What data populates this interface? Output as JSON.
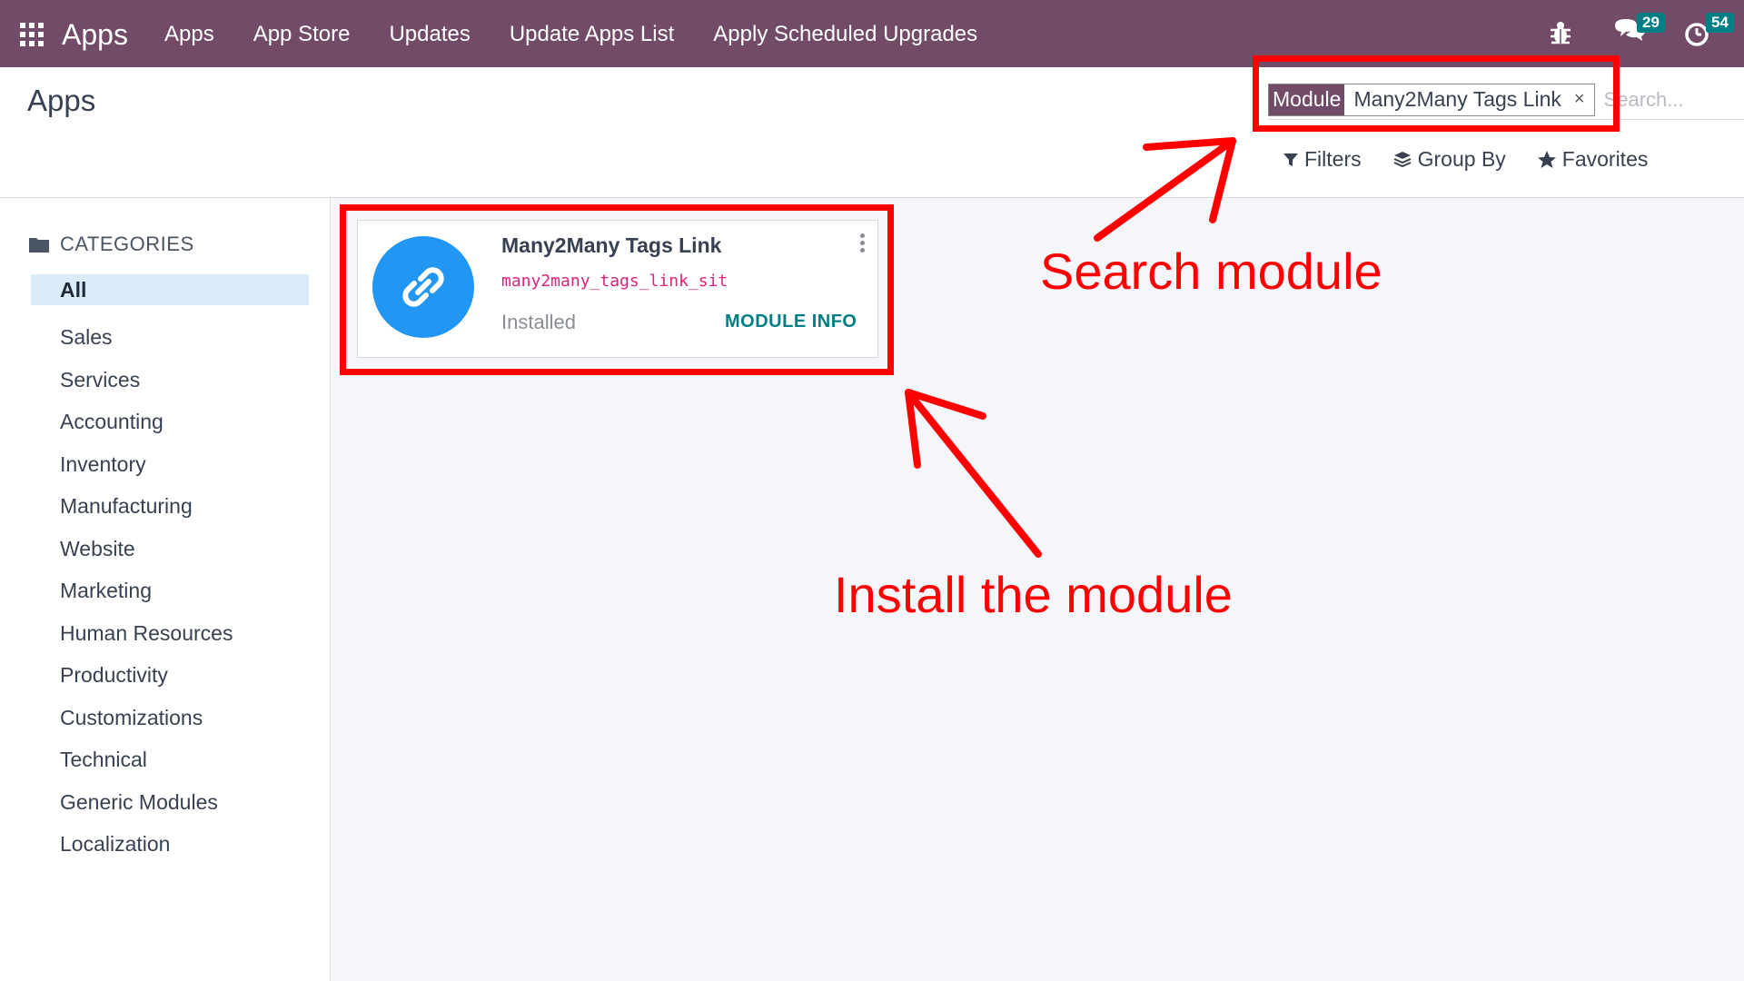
{
  "topbar": {
    "brand": "Apps",
    "menu": [
      "Apps",
      "App Store",
      "Updates",
      "Update Apps List",
      "Apply Scheduled Upgrades"
    ],
    "messages_count": "29",
    "activities_count": "54"
  },
  "control_panel": {
    "title": "Apps",
    "search": {
      "facet_label": "Module",
      "facet_value": "Many2Many Tags Link",
      "facet_close": "×",
      "placeholder": "Search..."
    },
    "filters_label": "Filters",
    "groupby_label": "Group By",
    "favorites_label": "Favorites"
  },
  "sidebar": {
    "header": "CATEGORIES",
    "items": [
      "All",
      "Sales",
      "Services",
      "Accounting",
      "Inventory",
      "Manufacturing",
      "Website",
      "Marketing",
      "Human Resources",
      "Productivity",
      "Customizations",
      "Technical",
      "Generic Modules",
      "Localization"
    ]
  },
  "module_card": {
    "title": "Many2Many Tags Link",
    "technical_name": "many2many_tags_link_sit",
    "status": "Installed",
    "info_button": "MODULE INFO"
  },
  "annotations": {
    "search_hint": "Search module",
    "install_hint": "Install the module",
    "color": "#ff0000"
  },
  "colors": {
    "brand": "#714b67",
    "accent": "#017e84",
    "icon_bg": "#2196f3"
  }
}
